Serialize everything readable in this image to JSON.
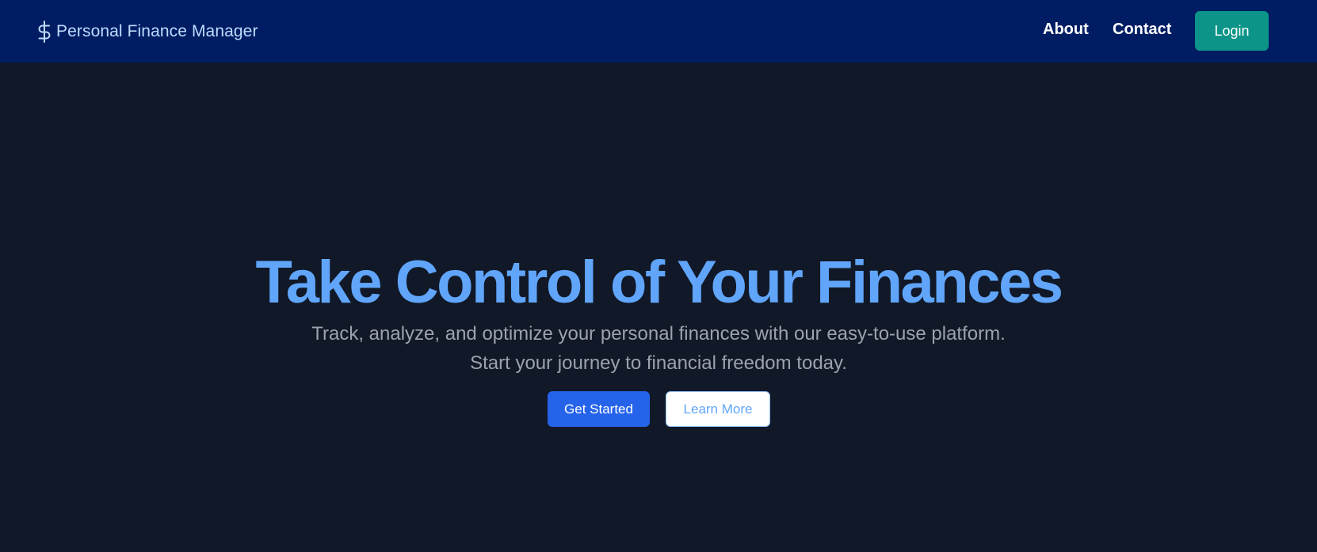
{
  "navbar": {
    "brand": {
      "icon": "dollar-sign-icon",
      "name": "Personal Finance Manager"
    },
    "links": [
      {
        "label": "About"
      },
      {
        "label": "Contact"
      }
    ],
    "login_label": "Login"
  },
  "hero": {
    "title": "Take Control of Your Finances",
    "subtitle": "Track, analyze, and optimize your personal finances with our easy-to-use platform. Start your journey to financial freedom today.",
    "primary_cta": "Get Started",
    "secondary_cta": "Learn More"
  },
  "colors": {
    "navbar_bg": "#001d63",
    "page_bg": "#111827",
    "accent_blue": "#60a5fa",
    "primary_button": "#2563eb",
    "login_button": "#0d9488"
  }
}
